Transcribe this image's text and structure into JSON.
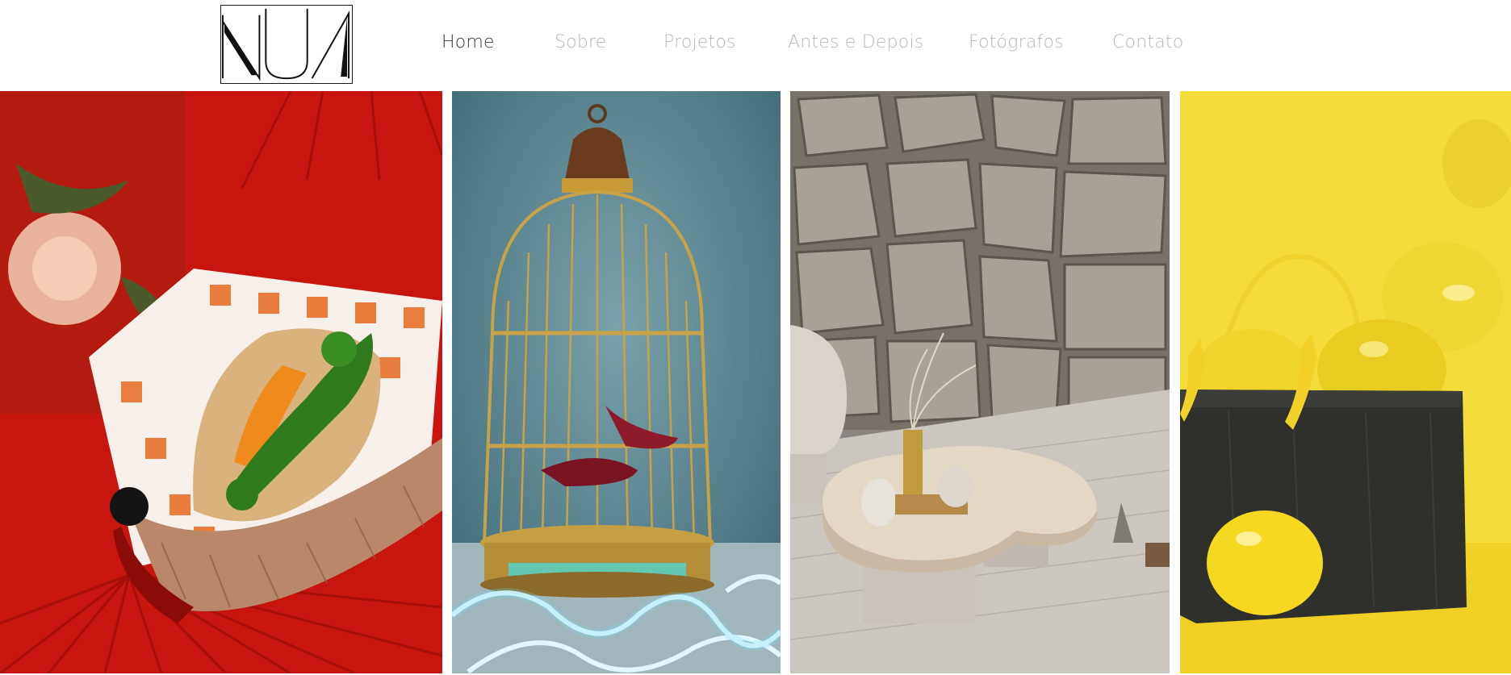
{
  "brand": {
    "logo_name": "NUA",
    "logo_icon": "nua-logo"
  },
  "nav": {
    "items": [
      {
        "label": "Home",
        "active": true
      },
      {
        "label": "Sobre",
        "active": false
      },
      {
        "label": "Projetos",
        "active": false
      },
      {
        "label": "Antes e Depois",
        "active": false
      },
      {
        "label": "Fotógrafos",
        "active": false
      },
      {
        "label": "Contato",
        "active": false
      }
    ]
  },
  "colors": {
    "nav_active": "#3a3a3a",
    "nav_inactive": "#b8b8b8",
    "tile1_bg": "#c8150f",
    "tile2_bg": "#5e8a95",
    "tile3_bg": "#8a8580",
    "tile4_bg": "#f4dc3a"
  },
  "gallery": {
    "tiles": [
      {
        "subject": "sandwich-basket-red-fans-photo"
      },
      {
        "subject": "birdcage-shoes-neon-photo"
      },
      {
        "subject": "stone-wall-coffee-table-photo"
      },
      {
        "subject": "yellow-balloons-black-bag-photo"
      }
    ]
  }
}
